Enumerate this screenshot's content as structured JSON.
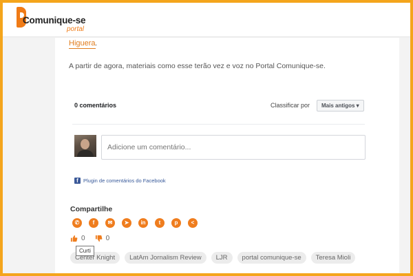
{
  "header": {
    "logo_text": "Comunique-se",
    "logo_sub": "portal"
  },
  "article": {
    "link_text": "Higuera",
    "link_suffix": ".",
    "paragraph": "A partir de agora, materiais como esse terão vez e voz no Portal Comunique-se."
  },
  "comments": {
    "count_label": "0 comentários",
    "sort_label": "Classificar por",
    "sort_value": "Mais antigos ▾",
    "input_placeholder": "Adicione um comentário...",
    "plugin_label": "Plugin de comentários do Facebook"
  },
  "share": {
    "title": "Compartilhe",
    "buttons": [
      {
        "icon": "whatsapp-icon",
        "glyph": "✆"
      },
      {
        "icon": "facebook-icon",
        "glyph": "f"
      },
      {
        "icon": "email-icon",
        "glyph": "✉"
      },
      {
        "icon": "telegram-icon",
        "glyph": "➤"
      },
      {
        "icon": "linkedin-icon",
        "glyph": "in"
      },
      {
        "icon": "twitter-icon",
        "glyph": "t"
      },
      {
        "icon": "pinterest-icon",
        "glyph": "p"
      },
      {
        "icon": "share-icon",
        "glyph": "<"
      }
    ]
  },
  "reactions": {
    "like_count": "0",
    "dislike_count": "0",
    "tooltip": "Curti"
  },
  "tags": [
    "Center Knight",
    "LatAm Jornalism Review",
    "LJR",
    "portal comunique-se",
    "Teresa Mioli"
  ],
  "colors": {
    "frame": "#f4a51c",
    "accent": "#ef7d1e",
    "facebook": "#3b5998"
  }
}
